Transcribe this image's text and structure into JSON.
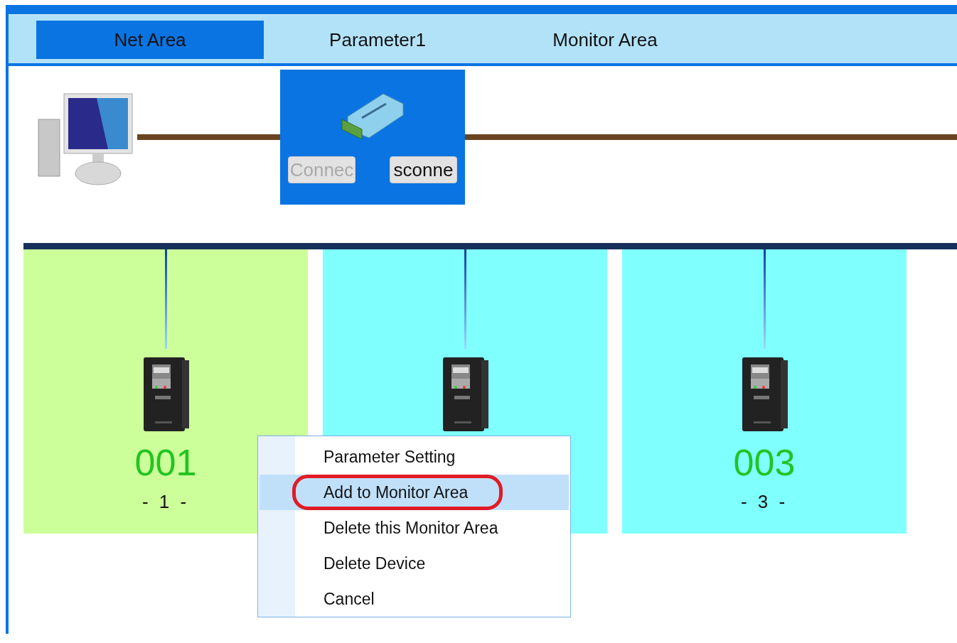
{
  "tabs": [
    {
      "label": "Net Area",
      "selected": true
    },
    {
      "label": "Parameter1",
      "selected": false
    },
    {
      "label": "Monitor Area",
      "selected": false
    }
  ],
  "converter": {
    "buttons": [
      {
        "label": "Connec",
        "disabled": true
      },
      {
        "label": "sconne",
        "disabled": false
      }
    ]
  },
  "devices": [
    {
      "color": "#ccff99",
      "code": "001",
      "number": "- 1 -"
    },
    {
      "color": "#80ffff"
    },
    {
      "color": "#80ffff",
      "code": "003",
      "number": "- 3 -"
    }
  ],
  "context_menu": {
    "items": [
      {
        "label": "Parameter Setting",
        "selected": false,
        "circled": false
      },
      {
        "label": "Add to Monitor Area",
        "selected": true,
        "circled": true
      },
      {
        "label": "Delete this Monitor Area",
        "selected": false,
        "circled": false
      },
      {
        "label": "Delete Device",
        "selected": false,
        "circled": false
      },
      {
        "label": "Cancel",
        "selected": false,
        "circled": false
      }
    ]
  }
}
